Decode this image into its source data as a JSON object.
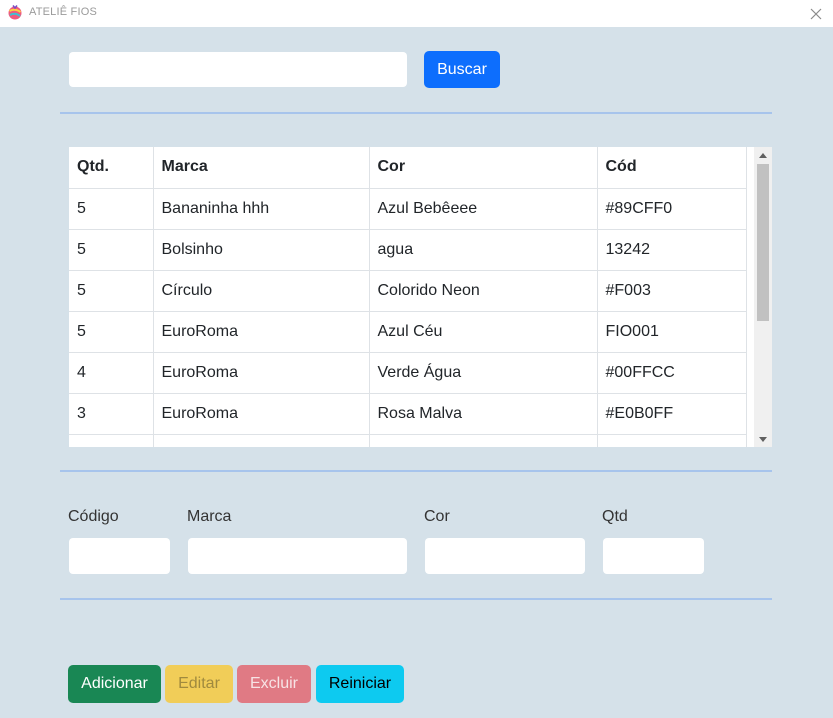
{
  "window": {
    "title": "ATELIÊ FIOS",
    "icon": "yarn-ball-icon",
    "close_icon": "close-icon"
  },
  "search": {
    "value": "",
    "placeholder": "",
    "button_label": "Buscar"
  },
  "table": {
    "headers": [
      "Qtd.",
      "Marca",
      "Cor",
      "Cód"
    ],
    "rows": [
      [
        "5",
        "Bananinha hhh",
        "Azul Bebêeee",
        "#89CFF0"
      ],
      [
        "5",
        "Bolsinho",
        "agua",
        "13242"
      ],
      [
        "5",
        "Círculo",
        "Colorido Neon",
        "#F003"
      ],
      [
        "5",
        "EuroRoma",
        "Azul Céu",
        "FIO001"
      ],
      [
        "4",
        "EuroRoma",
        "Verde Água",
        "#00FFCC"
      ],
      [
        "3",
        "EuroRoma",
        "Rosa Malva",
        "#E0B0FF"
      ],
      [
        "",
        "",
        "",
        ""
      ]
    ]
  },
  "form": {
    "codigo_label": "Código",
    "marca_label": "Marca",
    "cor_label": "Cor",
    "qtd_label": "Qtd",
    "codigo_value": "",
    "marca_value": "",
    "cor_value": "",
    "qtd_value": ""
  },
  "actions": {
    "add_label": "Adicionar",
    "edit_label": "Editar",
    "delete_label": "Excluir",
    "reset_label": "Reiniciar"
  },
  "colors": {
    "background": "#d5e1e9",
    "primary": "#0d6efd",
    "success": "#198754",
    "warning": "#f1cd58",
    "danger": "#e07a84",
    "info": "#0dcaf0",
    "divider": "#a7c4ec"
  }
}
